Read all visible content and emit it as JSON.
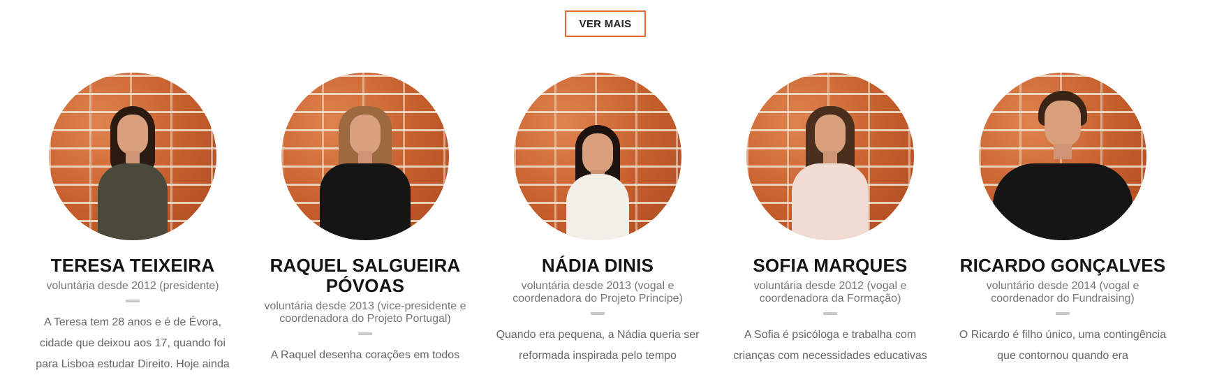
{
  "cta": {
    "label": "VER MAIS"
  },
  "members": [
    {
      "name": "TERESA TEIXEIRA",
      "role": "voluntária desde 2012 (presidente)",
      "bio": "A Teresa tem 28 anos e é de Évora, cidade que deixou aos 17, quando foi para Lisboa estudar Direito. Hoje ainda",
      "photo_alt": "Teresa Teixeira"
    },
    {
      "name": "RAQUEL SALGUEIRA PÓVOAS",
      "role": "voluntária desde 2013 (vice-presidente e coordenadora do Projeto Portugal)",
      "bio": "A Raquel desenha corações em todos",
      "photo_alt": "Raquel Salgueira Póvoas"
    },
    {
      "name": "NÁDIA DINIS",
      "role": "voluntária desde 2013 (vogal e coordenadora do Projeto Principe)",
      "bio": "Quando era pequena, a Nádia queria ser reformada inspirada pelo tempo",
      "photo_alt": "Nádia Dinis"
    },
    {
      "name": "SOFIA MARQUES",
      "role": "voluntária desde 2012 (vogal e coordenadora da Formação)",
      "bio": "A Sofia é psicóloga e trabalha com crianças com necessidades educativas",
      "photo_alt": "Sofia Marques"
    },
    {
      "name": "RICARDO GONÇALVES",
      "role": "voluntário desde 2014 (vogal e coordenador do Fundraising)",
      "bio": "O Ricardo é filho único, uma contingência que contornou quando era",
      "photo_alt": "Ricardo Gonçalves"
    }
  ],
  "colors": {
    "accent": "#e8652e",
    "name_text": "#141414",
    "role_text": "#777777",
    "bio_text": "#666666",
    "divider": "#c8c8c8",
    "brick": "#c9622e"
  }
}
